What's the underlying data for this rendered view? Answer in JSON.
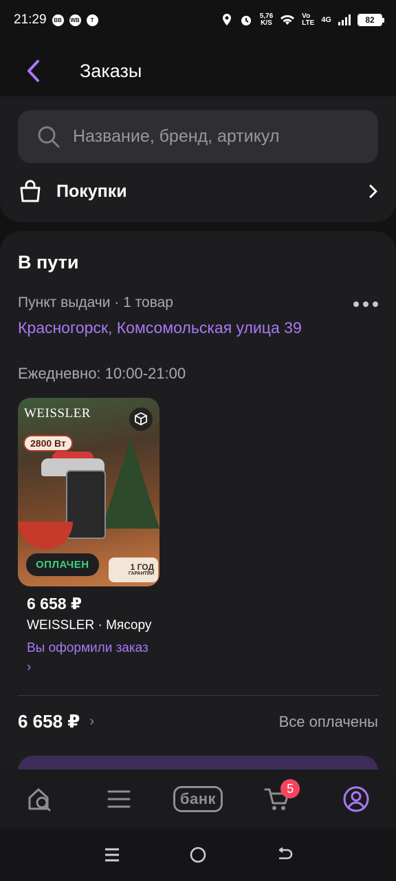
{
  "status_bar": {
    "time": "21:29",
    "mini_icons": [
      "BB",
      "WB",
      "T"
    ],
    "speed_value": "5,76",
    "speed_unit": "K/S",
    "volte": "Vo\nLTE",
    "network": "4G",
    "battery": "82"
  },
  "header": {
    "title": "Заказы"
  },
  "search": {
    "placeholder": "Название, бренд, артикул"
  },
  "purchases": {
    "label": "Покупки"
  },
  "order": {
    "section_title": "В пути",
    "pickup_meta": "Пункт выдачи · 1 товар",
    "address": "Красногорск, Комсомольская улица 39",
    "hours": "Ежедневно: 10:00-21:00",
    "product": {
      "image_brand": "WEISSLER",
      "image_power": "2800 Вт",
      "paid_badge": "ОПЛАЧЕН",
      "guarantee_badge": "1 ГОД",
      "guarantee_sub": "ГАРАНТИИ",
      "price": "6 658 ₽",
      "name": "WEISSLER · Мясорубка",
      "status": "Вы оформили заказ ›"
    },
    "total": "6 658 ₽",
    "total_status": "Все оплачены"
  },
  "bottom_nav": {
    "bank_label": "банк",
    "cart_count": "5"
  },
  "colors": {
    "accent": "#a978f5",
    "background": "#121213",
    "card": "#1d1d20",
    "paid_green": "#3ed17a",
    "badge_red": "#f5445e"
  }
}
